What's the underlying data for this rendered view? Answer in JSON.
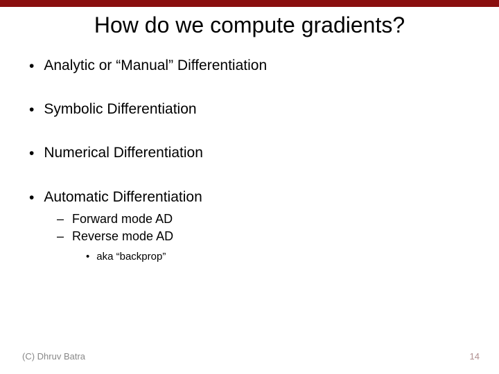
{
  "title": "How do we compute gradients?",
  "bullets": {
    "b1": "Analytic or “Manual” Differentiation",
    "b2": "Symbolic Differentiation",
    "b3": "Numerical Differentiation",
    "b4": "Automatic Differentiation",
    "b4_sub1": "Forward mode AD",
    "b4_sub2": "Reverse mode AD",
    "b4_sub2_note": "aka “backprop”"
  },
  "footer": {
    "left": "(C) Dhruv Batra",
    "right": "14"
  }
}
